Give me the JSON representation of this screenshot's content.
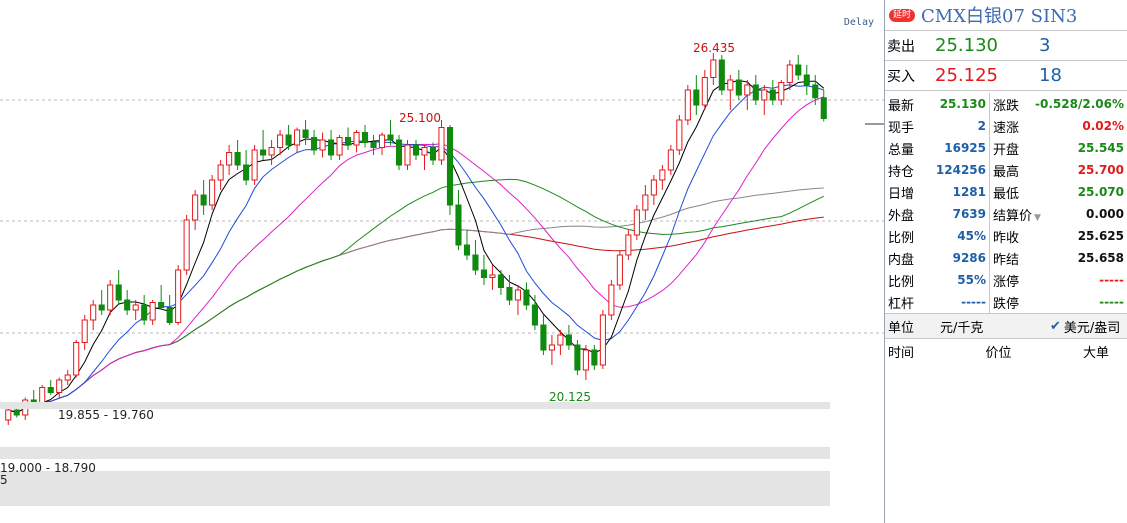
{
  "chart": {
    "delay_label": "Delay",
    "annotations": {
      "high_label": "26.435",
      "mid_high_label": "25.100",
      "low_label": "20.125"
    },
    "ranges": {
      "band_a": "19.855 - 19.760",
      "band_b": "19.000 - 18.790",
      "band_c_fragment": "5"
    },
    "colors": {
      "up": "#e3191c",
      "down": "#0f8a0f",
      "ma5": "#000000",
      "ma10": "#1e4dd8",
      "ma20": "#e020c8",
      "ma40": "#1c8a1c",
      "ma60": "#888888",
      "ma120": "#c81010"
    }
  },
  "chart_data": {
    "type": "candlestick",
    "candles": [
      [
        19.1,
        19.35,
        19.0,
        19.3
      ],
      [
        19.3,
        19.45,
        19.15,
        19.2
      ],
      [
        19.2,
        19.55,
        19.1,
        19.5
      ],
      [
        19.5,
        19.7,
        19.4,
        19.45
      ],
      [
        19.45,
        19.8,
        19.4,
        19.75
      ],
      [
        19.75,
        19.9,
        19.6,
        19.65
      ],
      [
        19.65,
        19.95,
        19.55,
        19.9
      ],
      [
        19.9,
        20.1,
        19.8,
        20.0
      ],
      [
        20.0,
        20.7,
        19.95,
        20.65
      ],
      [
        20.65,
        21.2,
        20.5,
        21.1
      ],
      [
        21.1,
        21.5,
        20.9,
        21.4
      ],
      [
        21.4,
        21.7,
        21.2,
        21.3
      ],
      [
        21.3,
        21.9,
        21.2,
        21.8
      ],
      [
        21.8,
        22.1,
        21.4,
        21.5
      ],
      [
        21.5,
        21.7,
        21.2,
        21.3
      ],
      [
        21.3,
        21.5,
        21.1,
        21.4
      ],
      [
        21.4,
        21.6,
        21.0,
        21.1
      ],
      [
        21.1,
        21.5,
        21.0,
        21.45
      ],
      [
        21.45,
        21.8,
        21.3,
        21.35
      ],
      [
        21.35,
        21.6,
        21.0,
        21.05
      ],
      [
        21.05,
        22.2,
        21.0,
        22.1
      ],
      [
        22.1,
        23.2,
        22.0,
        23.1
      ],
      [
        23.1,
        23.7,
        22.9,
        23.6
      ],
      [
        23.6,
        23.9,
        23.2,
        23.4
      ],
      [
        23.4,
        24.0,
        23.3,
        23.9
      ],
      [
        23.9,
        24.3,
        23.7,
        24.2
      ],
      [
        24.2,
        24.6,
        24.0,
        24.45
      ],
      [
        24.45,
        24.7,
        24.1,
        24.2
      ],
      [
        24.2,
        24.5,
        23.8,
        23.9
      ],
      [
        23.9,
        24.6,
        23.8,
        24.5
      ],
      [
        24.5,
        24.9,
        24.3,
        24.4
      ],
      [
        24.4,
        24.7,
        24.2,
        24.55
      ],
      [
        24.55,
        24.9,
        24.4,
        24.8
      ],
      [
        24.8,
        25.0,
        24.5,
        24.6
      ],
      [
        24.6,
        24.95,
        24.45,
        24.9
      ],
      [
        24.9,
        25.1,
        24.6,
        24.75
      ],
      [
        24.75,
        24.9,
        24.4,
        24.5
      ],
      [
        24.5,
        24.85,
        24.35,
        24.7
      ],
      [
        24.7,
        24.9,
        24.3,
        24.4
      ],
      [
        24.4,
        24.8,
        24.3,
        24.75
      ],
      [
        24.75,
        24.95,
        24.5,
        24.6
      ],
      [
        24.6,
        24.9,
        24.45,
        24.85
      ],
      [
        24.85,
        25.0,
        24.55,
        24.65
      ],
      [
        24.65,
        24.8,
        24.4,
        24.55
      ],
      [
        24.55,
        24.85,
        24.4,
        24.8
      ],
      [
        24.8,
        25.1,
        24.6,
        24.7
      ],
      [
        24.7,
        24.8,
        24.1,
        24.2
      ],
      [
        24.2,
        24.7,
        24.1,
        24.6
      ],
      [
        24.6,
        24.7,
        24.3,
        24.4
      ],
      [
        24.4,
        24.6,
        24.1,
        24.55
      ],
      [
        24.55,
        24.65,
        24.2,
        24.3
      ],
      [
        24.3,
        25.1,
        24.2,
        24.95
      ],
      [
        24.95,
        25.0,
        23.2,
        23.4
      ],
      [
        23.4,
        23.7,
        22.5,
        22.6
      ],
      [
        22.6,
        22.9,
        22.3,
        22.4
      ],
      [
        22.4,
        22.7,
        22.0,
        22.1
      ],
      [
        22.1,
        22.4,
        21.8,
        21.95
      ],
      [
        21.95,
        22.2,
        21.7,
        22.0
      ],
      [
        22.0,
        22.1,
        21.6,
        21.75
      ],
      [
        21.75,
        22.0,
        21.4,
        21.5
      ],
      [
        21.5,
        21.8,
        21.2,
        21.7
      ],
      [
        21.7,
        21.85,
        21.3,
        21.4
      ],
      [
        21.4,
        21.6,
        20.9,
        21.0
      ],
      [
        21.0,
        21.2,
        20.4,
        20.5
      ],
      [
        20.5,
        20.8,
        20.2,
        20.6
      ],
      [
        20.6,
        20.9,
        20.4,
        20.8
      ],
      [
        20.8,
        21.0,
        20.5,
        20.6
      ],
      [
        20.6,
        20.7,
        20.0,
        20.1
      ],
      [
        20.1,
        20.6,
        19.9,
        20.5
      ],
      [
        20.5,
        20.6,
        20.1,
        20.2
      ],
      [
        20.2,
        21.3,
        20.12,
        21.2
      ],
      [
        21.2,
        21.9,
        21.1,
        21.8
      ],
      [
        21.8,
        22.5,
        21.7,
        22.4
      ],
      [
        22.4,
        22.9,
        22.3,
        22.8
      ],
      [
        22.8,
        23.4,
        22.7,
        23.3
      ],
      [
        23.3,
        23.8,
        23.1,
        23.6
      ],
      [
        23.6,
        24.0,
        23.4,
        23.9
      ],
      [
        23.9,
        24.2,
        23.7,
        24.1
      ],
      [
        24.1,
        24.6,
        24.0,
        24.5
      ],
      [
        24.5,
        25.2,
        24.4,
        25.1
      ],
      [
        25.1,
        25.8,
        25.0,
        25.7
      ],
      [
        25.7,
        26.0,
        25.2,
        25.4
      ],
      [
        25.4,
        26.1,
        25.3,
        25.95
      ],
      [
        25.95,
        26.44,
        25.8,
        26.3
      ],
      [
        26.3,
        26.4,
        25.6,
        25.7
      ],
      [
        25.7,
        26.0,
        25.3,
        25.9
      ],
      [
        25.9,
        26.1,
        25.5,
        25.6
      ],
      [
        25.6,
        25.9,
        25.3,
        25.8
      ],
      [
        25.8,
        26.0,
        25.4,
        25.5
      ],
      [
        25.5,
        25.8,
        25.2,
        25.7
      ],
      [
        25.7,
        25.9,
        25.4,
        25.5
      ],
      [
        25.5,
        25.9,
        25.4,
        25.85
      ],
      [
        25.85,
        26.3,
        25.7,
        26.2
      ],
      [
        26.2,
        26.4,
        25.9,
        26.0
      ],
      [
        26.0,
        26.2,
        25.6,
        25.8
      ],
      [
        25.8,
        26.0,
        25.4,
        25.545
      ],
      [
        25.545,
        25.7,
        25.07,
        25.13
      ]
    ],
    "moving_averages": [
      "MA5",
      "MA10",
      "MA20",
      "MA40",
      "MA60",
      "MA120"
    ]
  },
  "panel": {
    "badge": "延时",
    "title": "CMX白银07  SIN3",
    "ask": {
      "label": "卖出",
      "price": "25.130",
      "volume": "3"
    },
    "bid": {
      "label": "买入",
      "price": "25.125",
      "volume": "18"
    },
    "stats": [
      {
        "l": "最新",
        "lv": "25.130",
        "lc": "green",
        "r": "涨跌",
        "rv": "-0.528/2.06%",
        "rc": "green"
      },
      {
        "l": "现手",
        "lv": "2",
        "lc": "blue",
        "r": "速涨",
        "rv": "0.02%",
        "rc": "red"
      },
      {
        "l": "总量",
        "lv": "16925",
        "lc": "blue",
        "r": "开盘",
        "rv": "25.545",
        "rc": "green"
      },
      {
        "l": "持仓",
        "lv": "124256",
        "lc": "blue",
        "r": "最高",
        "rv": "25.700",
        "rc": "red"
      },
      {
        "l": "日增",
        "lv": "1281",
        "lc": "blue",
        "r": "最低",
        "rv": "25.070",
        "rc": "green"
      },
      {
        "l": "外盘",
        "lv": "7639",
        "lc": "blue",
        "r": "结算价",
        "rv": "0.000",
        "rc": "dark"
      },
      {
        "l": "比例",
        "lv": "45%",
        "lc": "blue",
        "r": "昨收",
        "rv": "25.625",
        "rc": "dark"
      },
      {
        "l": "内盘",
        "lv": "9286",
        "lc": "blue",
        "r": "昨结",
        "rv": "25.658",
        "rc": "dark"
      },
      {
        "l": "比例",
        "lv": "55%",
        "lc": "blue",
        "r": "涨停",
        "rv": "-----",
        "rc": "red"
      },
      {
        "l": "杠杆",
        "lv": "-----",
        "lc": "blue",
        "r": "跌停",
        "rv": "-----",
        "rc": "green"
      }
    ],
    "unit": {
      "label": "单位",
      "option1": "元/千克",
      "option2": "美元/盎司"
    },
    "tick_header": {
      "col1": "时间",
      "col2": "价位",
      "col3": "大单"
    }
  }
}
